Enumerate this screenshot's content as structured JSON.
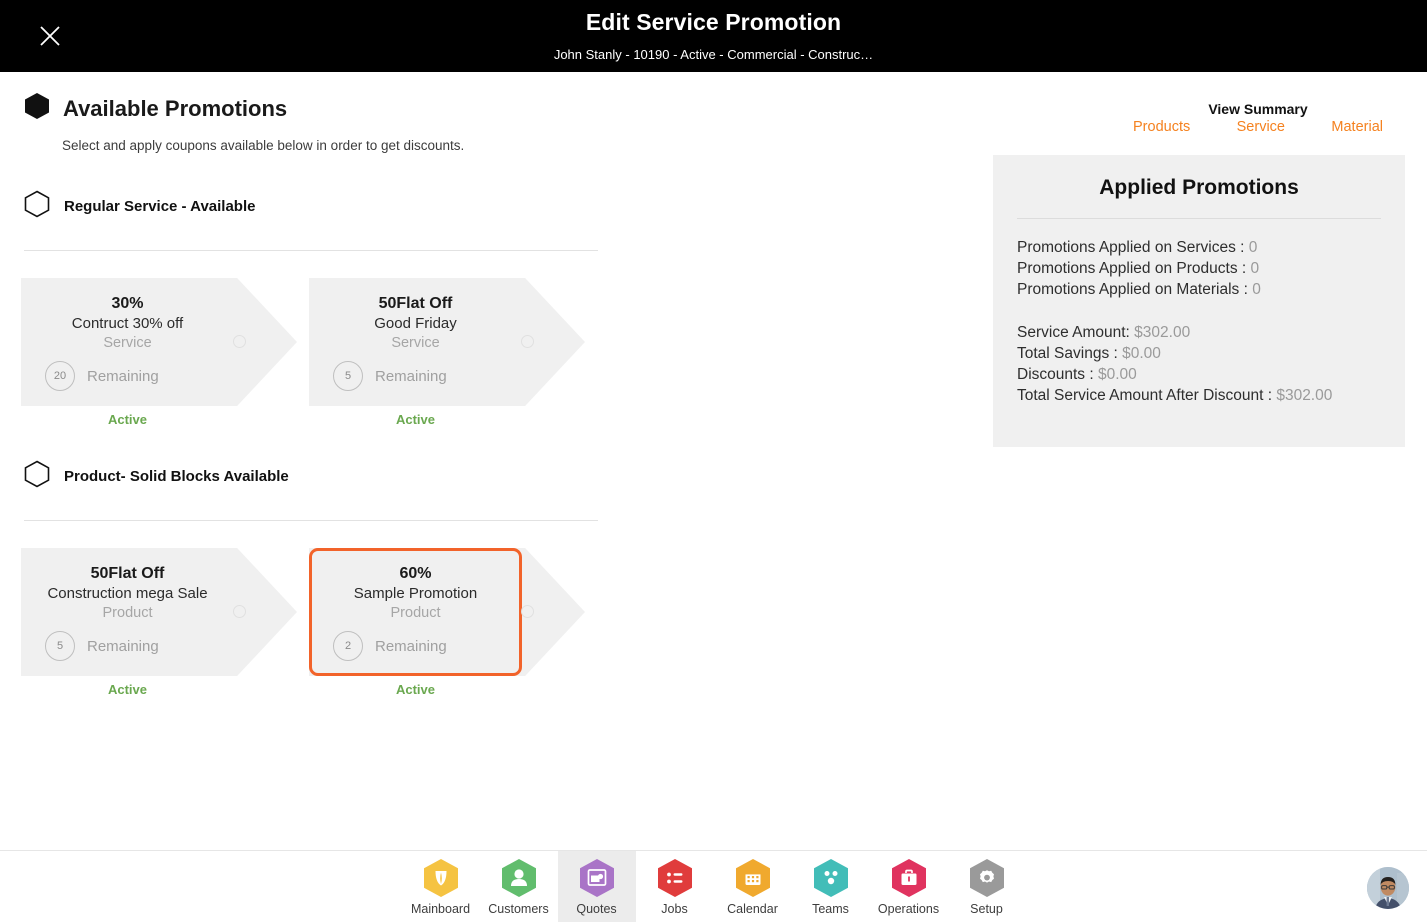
{
  "header": {
    "title": "Edit Service Promotion",
    "subtitle": "John Stanly - 10190 - Active - Commercial - Construc…",
    "close_icon": "close-icon"
  },
  "page": {
    "title": "Available Promotions",
    "subtitle": "Select and apply coupons available below in order to get discounts."
  },
  "view_summary": {
    "label": "View Summary",
    "links": [
      {
        "label": "Products",
        "name": "products"
      },
      {
        "label": "Service",
        "name": "service"
      },
      {
        "label": "Material",
        "name": "material"
      }
    ]
  },
  "sections": [
    {
      "title": "Regular Service - Available",
      "coupons": [
        {
          "percent": "30%",
          "name": "Contruct 30% off",
          "type": "Service",
          "remaining_count": "20",
          "remaining_label": "Remaining",
          "status": "Active",
          "selected": false
        },
        {
          "percent": "50Flat Off",
          "name": "Good Friday",
          "type": "Service",
          "remaining_count": "5",
          "remaining_label": "Remaining",
          "status": "Active",
          "selected": false
        }
      ]
    },
    {
      "title": "Product- Solid Blocks Available",
      "coupons": [
        {
          "percent": "50Flat Off",
          "name": "Construction mega Sale",
          "type": "Product",
          "remaining_count": "5",
          "remaining_label": "Remaining",
          "status": "Active",
          "selected": false
        },
        {
          "percent": "60%",
          "name": "Sample Promotion",
          "type": "Product",
          "remaining_count": "2",
          "remaining_label": "Remaining",
          "status": "Active",
          "selected": true
        }
      ]
    }
  ],
  "applied_promotions": {
    "title": "Applied Promotions",
    "counts": [
      {
        "label": "Promotions Applied on Services :",
        "value": "0"
      },
      {
        "label": "Promotions Applied on Products :",
        "value": "0"
      },
      {
        "label": "Promotions Applied on Materials :",
        "value": "0"
      }
    ],
    "amounts": [
      {
        "label": "Service Amount:",
        "value": "$302.00"
      },
      {
        "label": "Total Savings :",
        "value": "$0.00"
      },
      {
        "label": "Discounts :",
        "value": "$0.00"
      },
      {
        "label": "Total Service Amount After Discount :",
        "value": "$302.00"
      }
    ]
  },
  "bottom_nav": {
    "items": [
      {
        "label": "Mainboard",
        "icon": "mainboard-icon",
        "color": "#f5c342",
        "active": false
      },
      {
        "label": "Customers",
        "icon": "customers-icon",
        "color": "#61bd6d",
        "active": false
      },
      {
        "label": "Quotes",
        "icon": "quotes-icon",
        "color": "#a974c7",
        "active": true
      },
      {
        "label": "Jobs",
        "icon": "jobs-icon",
        "color": "#e03c3c",
        "active": false
      },
      {
        "label": "Calendar",
        "icon": "calendar-icon",
        "color": "#f0a92e",
        "active": false
      },
      {
        "label": "Teams",
        "icon": "teams-icon",
        "color": "#42bdb8",
        "active": false
      },
      {
        "label": "Operations",
        "icon": "operations-icon",
        "color": "#e0335f",
        "active": false
      },
      {
        "label": "Setup",
        "icon": "setup-icon",
        "color": "#9a9a9a",
        "active": false
      }
    ],
    "avatar_name": "user-avatar"
  },
  "colors": {
    "accent_orange": "#f58220",
    "selected_border": "#f2632a",
    "status_green": "#6aa84f",
    "panel_bg": "#f0f0f0",
    "card_bg": "#f0f0f0",
    "header_bg": "#000000"
  }
}
